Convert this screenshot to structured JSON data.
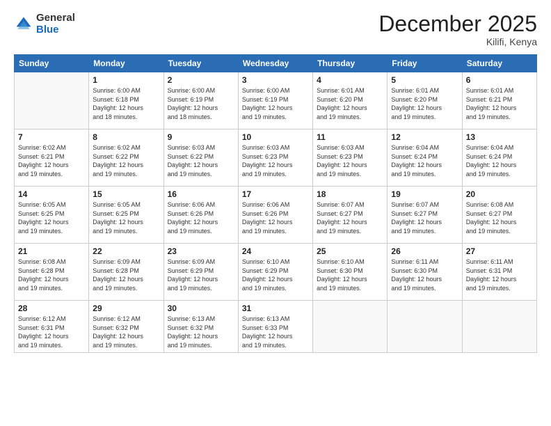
{
  "logo": {
    "general": "General",
    "blue": "Blue"
  },
  "header": {
    "month": "December 2025",
    "location": "Kilifi, Kenya"
  },
  "weekdays": [
    "Sunday",
    "Monday",
    "Tuesday",
    "Wednesday",
    "Thursday",
    "Friday",
    "Saturday"
  ],
  "weeks": [
    [
      {
        "day": "",
        "sunrise": "",
        "sunset": "",
        "daylight": ""
      },
      {
        "day": "1",
        "sunrise": "Sunrise: 6:00 AM",
        "sunset": "Sunset: 6:18 PM",
        "daylight": "Daylight: 12 hours and 18 minutes."
      },
      {
        "day": "2",
        "sunrise": "Sunrise: 6:00 AM",
        "sunset": "Sunset: 6:19 PM",
        "daylight": "Daylight: 12 hours and 18 minutes."
      },
      {
        "day": "3",
        "sunrise": "Sunrise: 6:00 AM",
        "sunset": "Sunset: 6:19 PM",
        "daylight": "Daylight: 12 hours and 19 minutes."
      },
      {
        "day": "4",
        "sunrise": "Sunrise: 6:01 AM",
        "sunset": "Sunset: 6:20 PM",
        "daylight": "Daylight: 12 hours and 19 minutes."
      },
      {
        "day": "5",
        "sunrise": "Sunrise: 6:01 AM",
        "sunset": "Sunset: 6:20 PM",
        "daylight": "Daylight: 12 hours and 19 minutes."
      },
      {
        "day": "6",
        "sunrise": "Sunrise: 6:01 AM",
        "sunset": "Sunset: 6:21 PM",
        "daylight": "Daylight: 12 hours and 19 minutes."
      }
    ],
    [
      {
        "day": "7",
        "sunrise": "Sunrise: 6:02 AM",
        "sunset": "Sunset: 6:21 PM",
        "daylight": "Daylight: 12 hours and 19 minutes."
      },
      {
        "day": "8",
        "sunrise": "Sunrise: 6:02 AM",
        "sunset": "Sunset: 6:22 PM",
        "daylight": "Daylight: 12 hours and 19 minutes."
      },
      {
        "day": "9",
        "sunrise": "Sunrise: 6:03 AM",
        "sunset": "Sunset: 6:22 PM",
        "daylight": "Daylight: 12 hours and 19 minutes."
      },
      {
        "day": "10",
        "sunrise": "Sunrise: 6:03 AM",
        "sunset": "Sunset: 6:23 PM",
        "daylight": "Daylight: 12 hours and 19 minutes."
      },
      {
        "day": "11",
        "sunrise": "Sunrise: 6:03 AM",
        "sunset": "Sunset: 6:23 PM",
        "daylight": "Daylight: 12 hours and 19 minutes."
      },
      {
        "day": "12",
        "sunrise": "Sunrise: 6:04 AM",
        "sunset": "Sunset: 6:24 PM",
        "daylight": "Daylight: 12 hours and 19 minutes."
      },
      {
        "day": "13",
        "sunrise": "Sunrise: 6:04 AM",
        "sunset": "Sunset: 6:24 PM",
        "daylight": "Daylight: 12 hours and 19 minutes."
      }
    ],
    [
      {
        "day": "14",
        "sunrise": "Sunrise: 6:05 AM",
        "sunset": "Sunset: 6:25 PM",
        "daylight": "Daylight: 12 hours and 19 minutes."
      },
      {
        "day": "15",
        "sunrise": "Sunrise: 6:05 AM",
        "sunset": "Sunset: 6:25 PM",
        "daylight": "Daylight: 12 hours and 19 minutes."
      },
      {
        "day": "16",
        "sunrise": "Sunrise: 6:06 AM",
        "sunset": "Sunset: 6:26 PM",
        "daylight": "Daylight: 12 hours and 19 minutes."
      },
      {
        "day": "17",
        "sunrise": "Sunrise: 6:06 AM",
        "sunset": "Sunset: 6:26 PM",
        "daylight": "Daylight: 12 hours and 19 minutes."
      },
      {
        "day": "18",
        "sunrise": "Sunrise: 6:07 AM",
        "sunset": "Sunset: 6:27 PM",
        "daylight": "Daylight: 12 hours and 19 minutes."
      },
      {
        "day": "19",
        "sunrise": "Sunrise: 6:07 AM",
        "sunset": "Sunset: 6:27 PM",
        "daylight": "Daylight: 12 hours and 19 minutes."
      },
      {
        "day": "20",
        "sunrise": "Sunrise: 6:08 AM",
        "sunset": "Sunset: 6:27 PM",
        "daylight": "Daylight: 12 hours and 19 minutes."
      }
    ],
    [
      {
        "day": "21",
        "sunrise": "Sunrise: 6:08 AM",
        "sunset": "Sunset: 6:28 PM",
        "daylight": "Daylight: 12 hours and 19 minutes."
      },
      {
        "day": "22",
        "sunrise": "Sunrise: 6:09 AM",
        "sunset": "Sunset: 6:28 PM",
        "daylight": "Daylight: 12 hours and 19 minutes."
      },
      {
        "day": "23",
        "sunrise": "Sunrise: 6:09 AM",
        "sunset": "Sunset: 6:29 PM",
        "daylight": "Daylight: 12 hours and 19 minutes."
      },
      {
        "day": "24",
        "sunrise": "Sunrise: 6:10 AM",
        "sunset": "Sunset: 6:29 PM",
        "daylight": "Daylight: 12 hours and 19 minutes."
      },
      {
        "day": "25",
        "sunrise": "Sunrise: 6:10 AM",
        "sunset": "Sunset: 6:30 PM",
        "daylight": "Daylight: 12 hours and 19 minutes."
      },
      {
        "day": "26",
        "sunrise": "Sunrise: 6:11 AM",
        "sunset": "Sunset: 6:30 PM",
        "daylight": "Daylight: 12 hours and 19 minutes."
      },
      {
        "day": "27",
        "sunrise": "Sunrise: 6:11 AM",
        "sunset": "Sunset: 6:31 PM",
        "daylight": "Daylight: 12 hours and 19 minutes."
      }
    ],
    [
      {
        "day": "28",
        "sunrise": "Sunrise: 6:12 AM",
        "sunset": "Sunset: 6:31 PM",
        "daylight": "Daylight: 12 hours and 19 minutes."
      },
      {
        "day": "29",
        "sunrise": "Sunrise: 6:12 AM",
        "sunset": "Sunset: 6:32 PM",
        "daylight": "Daylight: 12 hours and 19 minutes."
      },
      {
        "day": "30",
        "sunrise": "Sunrise: 6:13 AM",
        "sunset": "Sunset: 6:32 PM",
        "daylight": "Daylight: 12 hours and 19 minutes."
      },
      {
        "day": "31",
        "sunrise": "Sunrise: 6:13 AM",
        "sunset": "Sunset: 6:33 PM",
        "daylight": "Daylight: 12 hours and 19 minutes."
      },
      {
        "day": "",
        "sunrise": "",
        "sunset": "",
        "daylight": ""
      },
      {
        "day": "",
        "sunrise": "",
        "sunset": "",
        "daylight": ""
      },
      {
        "day": "",
        "sunrise": "",
        "sunset": "",
        "daylight": ""
      }
    ]
  ]
}
